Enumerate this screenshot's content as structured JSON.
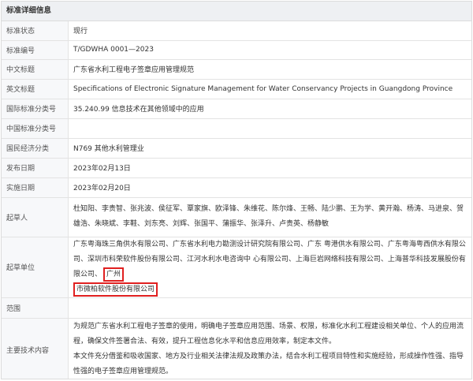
{
  "header": {
    "title": "标准详细信息"
  },
  "rows": [
    {
      "label": "标准状态",
      "value": "现行"
    },
    {
      "label": "标准编号",
      "value": "T/GDWHA 0001—2023"
    },
    {
      "label": "中文标题",
      "value": "广东省水利工程电子签章应用管理规范"
    },
    {
      "label": "英文标题",
      "value": "Specifications of Electronic Signature Management for Water Conservancy Projects in Guangdong Province"
    },
    {
      "label": "国际标准分类号",
      "value": "35.240.99 信息技术在其他领域中的应用"
    },
    {
      "label": "中国标准分类号",
      "value": ""
    },
    {
      "label": "国民经济分类",
      "value": "N769 其他水利管理业"
    },
    {
      "label": "发布日期",
      "value": "2023年02月13日"
    },
    {
      "label": "实施日期",
      "value": "2023年02月20日"
    }
  ],
  "drafters": {
    "label": "起草人",
    "value": "杜知阳、李贵智、张兆波、侯征军、覃家旗、欧泽锋、朱维花、陈尔烽、王畅、陆少鹏、王为学、黄开瀚、杨涛、马进泉、贺雄浩、朱晓斌、李鞋、刘东亮、刘辉、张国平、蒲振华、张泽升、卢贵英、杨静敏"
  },
  "drafting_units": {
    "label": "起草单位",
    "value_main": "广东粤海珠三角供水有限公司、广东省水利电力勘测设计研究院有限公司、广东 粤港供水有限公司、广东粤海粤西供水有限公司、深圳市科荣软件股份有限公司、江河水利水电咨询中 心有限公司、上海巨岩网络科技有限公司、上海普华科技发展股份有限公司、",
    "value_hl_1": "广州",
    "value_hl_2": "市微柏软件股份有限公司"
  },
  "scope": {
    "label": "范围",
    "value": ""
  },
  "tech_content": {
    "label": "主要技术内容",
    "para1": "为规范广东省水利工程电子签章的使用，明确电子签章应用范围、场景、权限，标准化水利工程建设相关单位、个人的应用流程，确保文件签署合法、有效，提升工程信息化水平和信息应用效率，制定本文件。",
    "para2": "本文件充分借鉴和吸收国家、地方及行业相关法律法规及政策办法，结合水利工程项目特性和实施经验，形成操作性强、指导性强的电子签章应用管理规范。"
  },
  "colors": {
    "highlight_border": "#e02020",
    "label_bg": "#f7f8fa",
    "header_bg": "#eef0f3"
  }
}
